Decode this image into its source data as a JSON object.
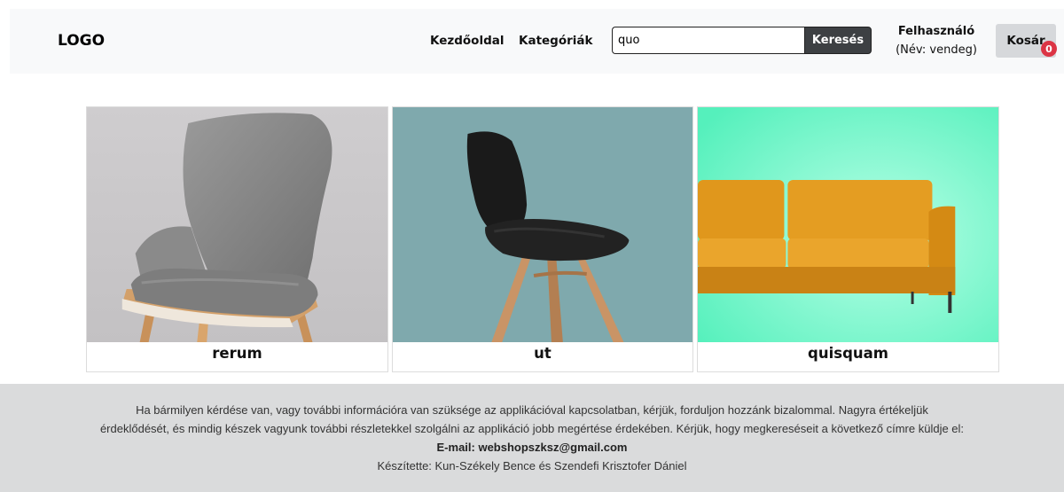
{
  "navbar": {
    "logo": "LOGO",
    "links": [
      {
        "label": "Kezdőoldal"
      },
      {
        "label": "Kategóriák"
      }
    ],
    "search": {
      "value": "quo",
      "button_label": "Keresés"
    },
    "user": {
      "title": "Felhasználó",
      "name_line": "(Név: vendeg)"
    },
    "cart": {
      "label": "Kosár",
      "count": "0"
    }
  },
  "products": [
    {
      "name": "rerum",
      "image": "gray-armchair-photo"
    },
    {
      "name": "ut",
      "image": "black-chair-photo"
    },
    {
      "name": "quisquam",
      "image": "orange-sofa-photo"
    }
  ],
  "footer": {
    "line1": "Ha bármilyen kérdése van, vagy további információra van szüksége az applikációval kapcsolatban, kérjük, forduljon hozzánk bizalommal. Nagyra értékeljük",
    "line2": "érdeklődését, és mindig készek vagyunk további részletekkel szolgálni az applikáció jobb megértése érdekében. Kérjük, hogy megkereséseit a következő címre küldje el:",
    "email": "E-mail: webshopszksz@gmail.com",
    "credits": "Készítette: Kun-Székely Bence és Szendefi Krisztofer Dániel"
  },
  "colors": {
    "navbar_bg": "#f8f9fa",
    "search_button_bg": "#3d4043",
    "cart_button_bg": "#d6d8db",
    "badge_bg": "#dc3545",
    "footer_bg": "#dadbdc"
  }
}
